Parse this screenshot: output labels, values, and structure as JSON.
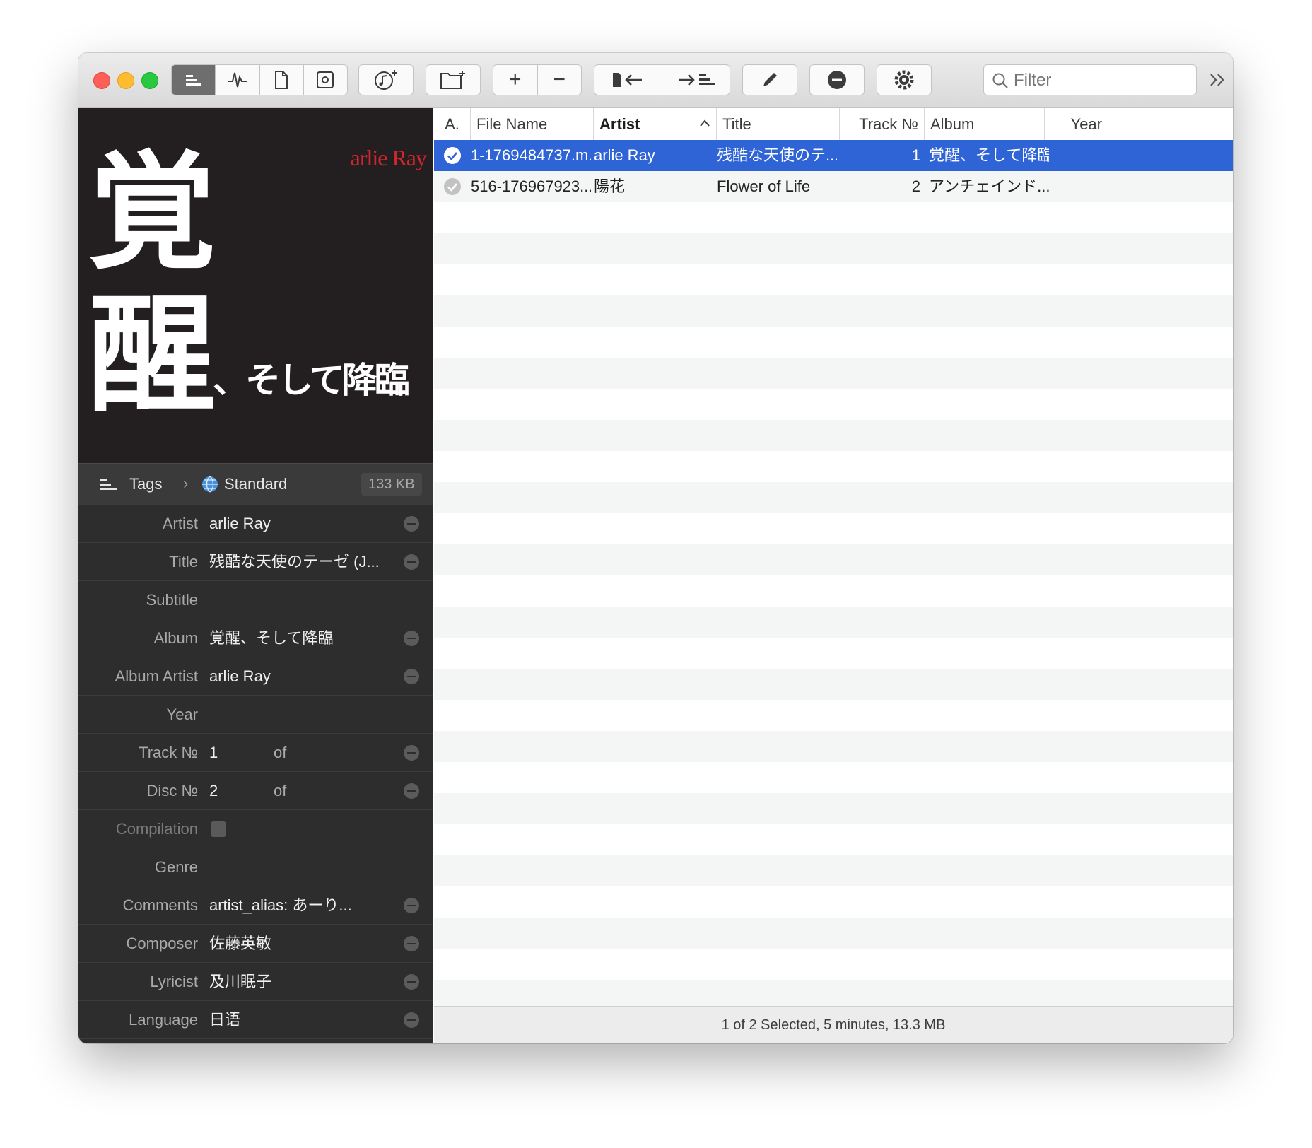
{
  "toolbar": {
    "filter_placeholder": "Filter",
    "tool_icons": [
      "tags-view-icon",
      "waveform-icon",
      "document-icon",
      "artwork-icon",
      "music-add-icon",
      "folder-add-icon",
      "add-icon",
      "remove-icon",
      "import-tags-icon",
      "export-tags-icon",
      "pencil-icon",
      "remove-tag-icon",
      "gear-icon",
      "search-icon",
      "overflow-chevron-icon"
    ]
  },
  "cover": {
    "artist": "arlie Ray",
    "title_big1": "覚",
    "title_big2": "醒",
    "title_rest": "、そして降臨"
  },
  "crumb": {
    "tags_label": "Tags",
    "standard_label": "Standard",
    "size": "133 KB"
  },
  "fields": [
    {
      "label": "Artist",
      "value": "arlie Ray",
      "minus": true
    },
    {
      "label": "Title",
      "value": "残酷な天使のテーゼ (J...",
      "minus": true
    },
    {
      "label": "Subtitle",
      "value": "",
      "minus": false
    },
    {
      "label": "Album",
      "value": "覚醒、そして降臨",
      "minus": true
    },
    {
      "label": "Album Artist",
      "value": "arlie Ray",
      "minus": true
    },
    {
      "label": "Year",
      "value": "",
      "minus": false
    },
    {
      "label": "Track №",
      "value": "1",
      "of": "of",
      "minus": true
    },
    {
      "label": "Disc №",
      "value": "2",
      "of": "of",
      "minus": true
    },
    {
      "label": "Compilation",
      "value": "",
      "checkbox": true,
      "minus": false
    },
    {
      "label": "Genre",
      "value": "",
      "minus": false
    },
    {
      "label": "Comments",
      "value": "artist_alias: あーり...",
      "minus": true
    },
    {
      "label": "Composer",
      "value": "佐藤英敏",
      "minus": true
    },
    {
      "label": "Lyricist",
      "value": "及川眠子",
      "minus": true
    },
    {
      "label": "Language",
      "value": "日语",
      "minus": true
    }
  ],
  "table": {
    "columns": [
      "A.",
      "File Name",
      "Artist",
      "Title",
      "Track №",
      "Album",
      "Year"
    ],
    "sort_column": "Artist",
    "rows": [
      {
        "file": "1-1769484737.m...",
        "artist": "arlie Ray",
        "title": "残酷な天使のテ...",
        "track": "1",
        "album": "覚醒、そして降臨",
        "year": "",
        "selected": true
      },
      {
        "file": "516-176967923...",
        "artist": "陽花",
        "title": "Flower of Life",
        "track": "2",
        "album": "アンチェインド...",
        "year": "",
        "selected": false
      }
    ]
  },
  "status": "1 of 2 Selected, 5 minutes, 13.3 MB",
  "colors": {
    "selection": "#2f64d6",
    "panel": "#2d2d2d",
    "cover_red": "#d1262e"
  }
}
